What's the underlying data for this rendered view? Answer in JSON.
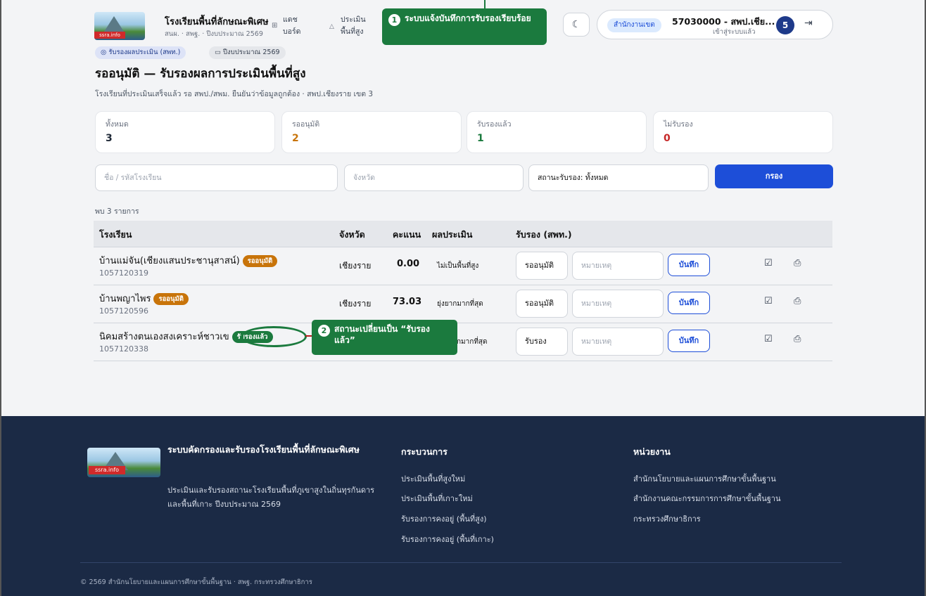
{
  "header": {
    "school_name": "โรงเรียนพื้นที่ลักษณะพิเศษ",
    "school_sub": "สนผ. · สพฐ. · ปีงบประมาณ 2569",
    "logo_text": "ssra.info",
    "nav": [
      {
        "label": "แดช บอร์ด",
        "icon": "grid-icon"
      },
      {
        "label": "ประเมิน พื้นที่สูง",
        "icon": "mountain-icon"
      }
    ],
    "office_chip": "สำนักงานเขต",
    "user_code": "57030000 - สพป.เชีย...",
    "user_status": "เข้าสู่ระบบแล้ว",
    "avatar_count": "5",
    "icons": {
      "theme": "moon-icon",
      "logout": "logout-icon"
    }
  },
  "toasts": {
    "first": {
      "number": "1",
      "text": "ระบบแจ้งบันทึกการรับรองเรียบร้อย"
    },
    "second": {
      "number": "2",
      "text": "สถานะเปลี่ยนเป็น “รับรองแล้ว”"
    }
  },
  "page": {
    "chips": [
      "รับรองผลประเมิน (สพท.)",
      "ปีงบประมาณ 2569"
    ],
    "title": "รออนุมัติ — รับรองผลการประเมินพื้นที่สูง",
    "description": "โรงเรียนที่ประเมินเสร็จแล้ว รอ สพป./สพม. ยืนยันว่าข้อมูลถูกต้อง · สพป.เชียงราย เขต 3"
  },
  "stats": [
    {
      "label": "ทั้งหมด",
      "value": "3",
      "color": "#1f2937"
    },
    {
      "label": "รออนุมัติ",
      "value": "2",
      "color": "#c8740a"
    },
    {
      "label": "รับรองแล้ว",
      "value": "1",
      "color": "#1b7a3e"
    },
    {
      "label": "ไม่รับรอง",
      "value": "0",
      "color": "#c62828"
    }
  ],
  "filters": {
    "name_placeholder": "ชื่อ / รหัสโรงเรียน",
    "province_placeholder": "จังหวัด",
    "status_value": "สถานะรับรอง: ทั้งหมด",
    "button": "กรอง"
  },
  "found_text": "พบ 3 รายการ",
  "table": {
    "headers": [
      "โรงเรียน",
      "จังหวัด",
      "คะแนน",
      "ผลประเมิน",
      "รับรอง (สพท.)"
    ],
    "note_placeholder": "หมายเหตุ",
    "save_label": "บันทึก",
    "rows": [
      {
        "name": "บ้านแม่จัน(เชียงแสนประชานุสาสน์)",
        "badge": "รออนุมัติ",
        "badge_type": "pending",
        "code": "1057120319",
        "province": "เชียงราย",
        "score": "0.00",
        "result": "ไม่เป็นพื้นที่สูง",
        "status": "รออนุมัติ"
      },
      {
        "name": "บ้านพญาไพร",
        "badge": "รออนุมัติ",
        "badge_type": "pending",
        "code": "1057120596",
        "province": "เชียงราย",
        "score": "73.03",
        "result": "ยุ่งยากมากที่สุด",
        "status": "รออนุมัติ"
      },
      {
        "name": "นิคมสร้างตนเองสงเคราะห์ชาวเข",
        "badge": "รับรองแล้ว",
        "badge_type": "approved",
        "code": "1057120338",
        "province": "",
        "score": "",
        "result": "กมากที่สุด",
        "status": "รับรอง"
      }
    ]
  },
  "footer": {
    "title": "ระบบคัดกรองและรับรองโรงเรียนพื้นที่ลักษณะพิเศษ",
    "description": "ประเมินและรับรองสถานะโรงเรียนพื้นที่ภูเขาสูงในถิ่นทุรกันดารและพื้นที่เกาะ ปีงบประมาณ 2569",
    "process_heading": "กระบวนการ",
    "process_links": [
      "ประเมินพื้นที่สูงใหม่",
      "ประเมินพื้นที่เกาะใหม่",
      "รับรองการคงอยู่ (พื้นที่สูง)",
      "รับรองการคงอยู่ (พื้นที่เกาะ)"
    ],
    "agency_heading": "หน่วยงาน",
    "agency_links": [
      "สำนักนโยบายและแผนการศึกษาขั้นพื้นฐาน",
      "สำนักงานคณะกรรมการการศึกษาขั้นพื้นฐาน",
      "กระทรวงศึกษาธิการ"
    ],
    "copyright": "© 2569 สำนักนโยบายและแผนการศึกษาขั้นพื้นฐาน · สพฐ. กระทรวงศึกษาธิการ"
  }
}
